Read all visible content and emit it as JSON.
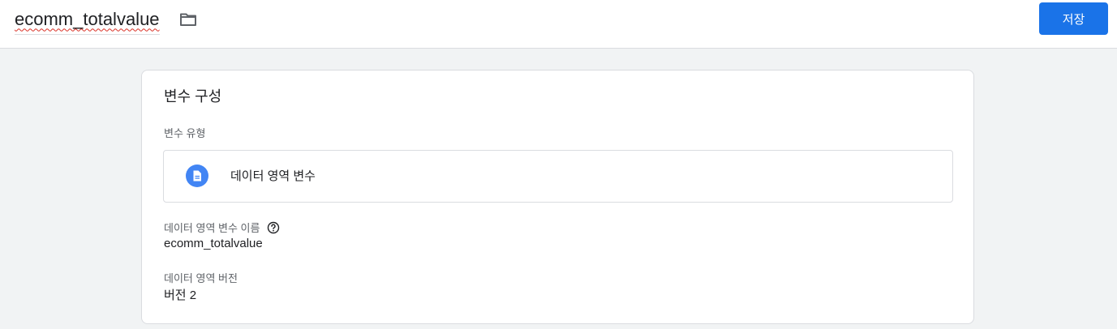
{
  "header": {
    "title": "ecomm_totalvalue",
    "folder_icon": "folder-icon",
    "save_label": "저장"
  },
  "card": {
    "title": "변수 구성",
    "type_label": "변수 유형",
    "type_name": "데이터 영역 변수",
    "type_icon": "document-icon",
    "fields": [
      {
        "label": "데이터 영역 변수 이름",
        "value": "ecomm_totalvalue",
        "has_help": true
      },
      {
        "label": "데이터 영역 버전",
        "value": "버전 2",
        "has_help": false
      }
    ]
  },
  "colors": {
    "accent": "#1a73e8",
    "icon_blue": "#4285f4",
    "background": "#f1f3f4",
    "border": "#dadce0"
  }
}
